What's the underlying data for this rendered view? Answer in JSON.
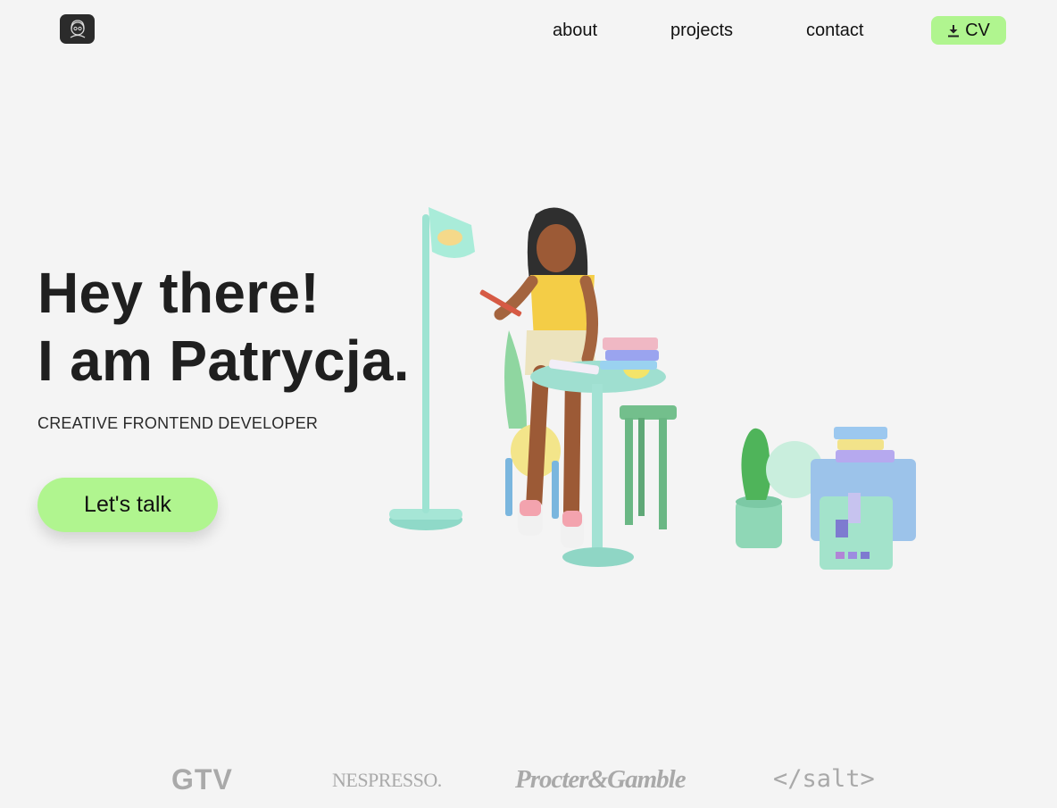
{
  "header": {
    "logo_icon": "girl-avatar-icon",
    "nav": {
      "about": "about",
      "projects": "projects",
      "contact": "contact"
    },
    "cv_button": {
      "icon": "download-icon",
      "label": "CV"
    }
  },
  "hero": {
    "title_line1": "Hey there!",
    "title_line2": "I am Patrycja.",
    "subtitle": "CREATIVE FRONTEND DEVELOPER",
    "cta_label": "Let's talk"
  },
  "brands": {
    "gtv": "GTV",
    "nespresso": "NESPRESSO.",
    "pg": "Procter&Gamble",
    "salt": "</salt>"
  },
  "colors": {
    "accent": "#b0f58f",
    "background": "#f4f4f4",
    "text": "#1f1f1f",
    "brand_gray": "#a9a9a9"
  }
}
